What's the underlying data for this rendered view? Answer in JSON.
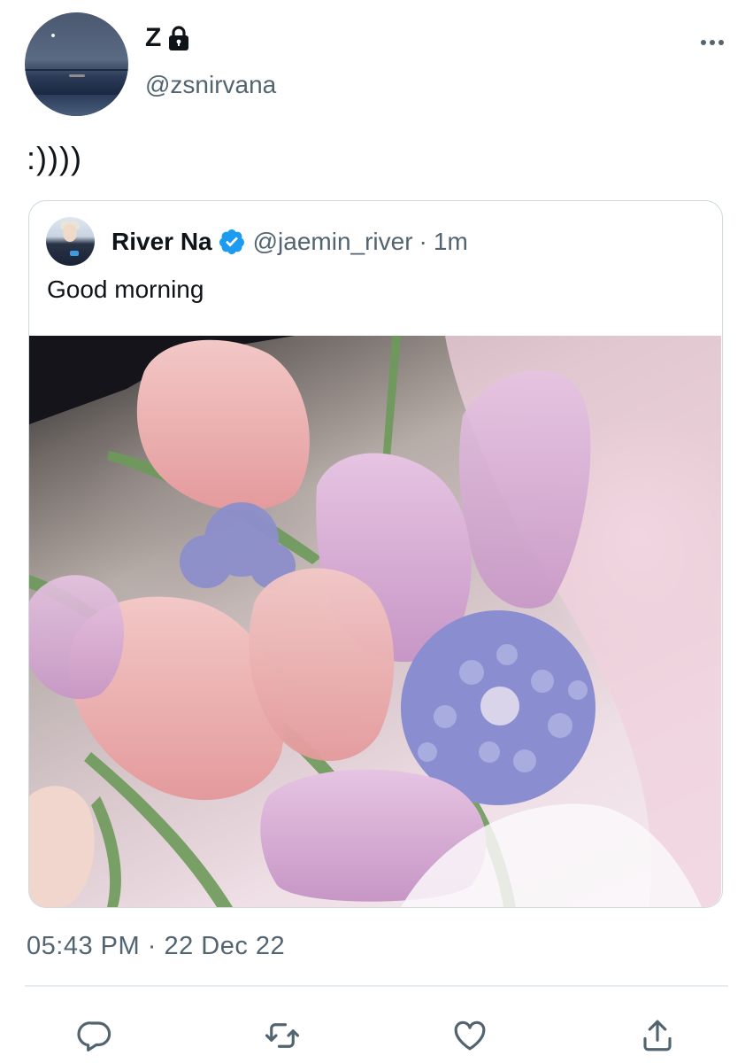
{
  "tweet": {
    "author": {
      "display_name": "Z",
      "handle": "@zsnirvana",
      "locked": true,
      "avatar_icon": "ocean-moon-avatar"
    },
    "text": ":))))",
    "timestamp": "05:43 PM",
    "separator": "·",
    "date": "22 Dec 22"
  },
  "quote": {
    "author": {
      "display_name": "River Na",
      "handle": "@jaemin_river",
      "verified": true,
      "avatar_icon": "profile-photo"
    },
    "separator": "·",
    "time": "1m",
    "text": "Good morning",
    "media_icon": "tulip-bouquet-photo"
  },
  "actions": [
    "reply-icon",
    "retweet-icon",
    "like-icon",
    "share-icon"
  ],
  "colors": {
    "text": "#0f1419",
    "secondary": "#536471",
    "border": "#cfd9de",
    "verified": "#1d9bf0"
  }
}
